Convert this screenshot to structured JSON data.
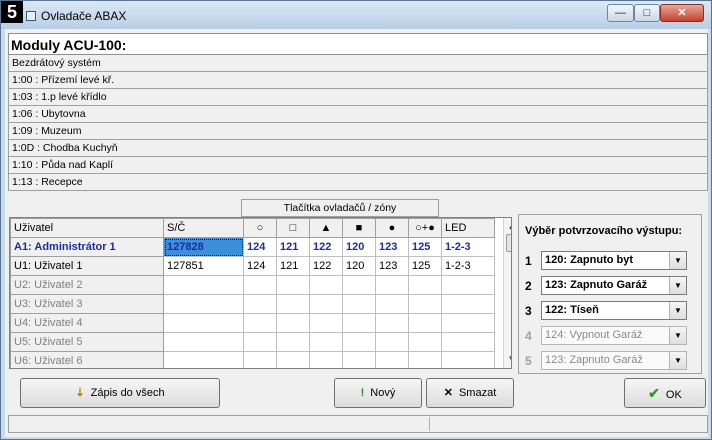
{
  "window": {
    "corner_number": "5",
    "title": "Ovladače ABAX",
    "background_title": "...",
    "controls": {
      "minimize": "—",
      "maximize": "□",
      "close": "✕"
    }
  },
  "modules": {
    "header": "Moduly ACU-100:",
    "items": [
      "Bezdrátový systém",
      "1:00 :  Přízemí levé kř.",
      "1:03 :  1.p levé křídlo",
      "1:06 :  Ubytovna",
      "1:09 :  Muzeum",
      "1:0D :  Chodba Kuchyň",
      "1:10 :  Půda nad Kaplí",
      "1:13 :  Recepce"
    ]
  },
  "table": {
    "caption": "Tlačítka ovladačů / zóny",
    "headers": {
      "user": "Uživatel",
      "serial": "S/Č",
      "b1": "○",
      "b2": "□",
      "b3": "▲",
      "b4": "■",
      "b5": "●",
      "b6": "○+●",
      "led": "LED"
    },
    "rows": [
      {
        "user": "A1: Administrátor 1",
        "serial": "127828",
        "b1": "124",
        "b2": "121",
        "b3": "122",
        "b4": "120",
        "b5": "123",
        "b6": "125",
        "led": "1-2-3"
      },
      {
        "user": "U1: Uživatel  1",
        "serial": "127851",
        "b1": "124",
        "b2": "121",
        "b3": "122",
        "b4": "120",
        "b5": "123",
        "b6": "125",
        "led": "1-2-3"
      },
      {
        "user": "U2: Uživatel  2",
        "serial": "",
        "b1": "",
        "b2": "",
        "b3": "",
        "b4": "",
        "b5": "",
        "b6": "",
        "led": ""
      },
      {
        "user": "U3: Uživatel  3",
        "serial": "",
        "b1": "",
        "b2": "",
        "b3": "",
        "b4": "",
        "b5": "",
        "b6": "",
        "led": ""
      },
      {
        "user": "U4: Uživatel  4",
        "serial": "",
        "b1": "",
        "b2": "",
        "b3": "",
        "b4": "",
        "b5": "",
        "b6": "",
        "led": ""
      },
      {
        "user": "U5: Uživatel  5",
        "serial": "",
        "b1": "",
        "b2": "",
        "b3": "",
        "b4": "",
        "b5": "",
        "b6": "",
        "led": ""
      },
      {
        "user": "U6: Uživatel  6",
        "serial": "",
        "b1": "",
        "b2": "",
        "b3": "",
        "b4": "",
        "b5": "",
        "b6": "",
        "led": ""
      }
    ],
    "scroll_up": "▲",
    "scroll_down": "▼"
  },
  "outputs": {
    "title": "Výběr potvrzovacího výstupu:",
    "items": [
      {
        "num": "1",
        "value": "120: Zapnuto byt",
        "enabled": true
      },
      {
        "num": "2",
        "value": "123: Zapnuto Garáž",
        "enabled": true
      },
      {
        "num": "3",
        "value": "122: Tíseň",
        "enabled": true
      },
      {
        "num": "4",
        "value": "124: Vypnout Garáž",
        "enabled": false
      },
      {
        "num": "5",
        "value": "123: Zapnuto Garáž",
        "enabled": false
      }
    ],
    "dropdown_glyph": "▼"
  },
  "buttons": {
    "save_all": {
      "label": "Zápis do všech",
      "icon": "write-all-icon",
      "glyph": "⇣"
    },
    "new": {
      "label": "Nový",
      "icon": "exclamation-icon",
      "glyph": "!"
    },
    "delete": {
      "label": "Smazat",
      "icon": "x-icon",
      "glyph": "✕"
    },
    "ok": {
      "label": "OK",
      "icon": "checkmark-icon",
      "glyph": "✔"
    }
  }
}
